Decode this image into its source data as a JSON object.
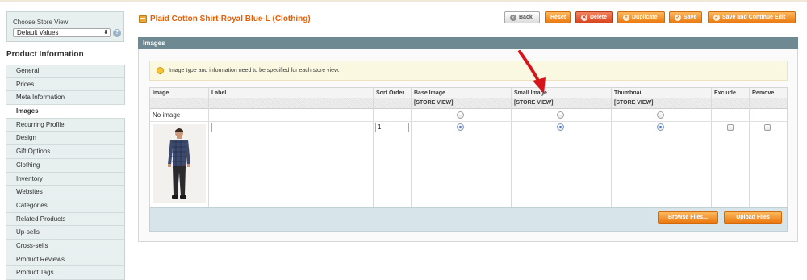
{
  "sidebar": {
    "store_view_label": "Choose Store View:",
    "store_view_value": "Default Values",
    "section_title": "Product Information",
    "items": [
      {
        "label": "General",
        "active": false
      },
      {
        "label": "Prices",
        "active": false
      },
      {
        "label": "Meta Information",
        "active": false
      },
      {
        "label": "Images",
        "active": true
      },
      {
        "label": "Recurring Profile",
        "active": false
      },
      {
        "label": "Design",
        "active": false
      },
      {
        "label": "Gift Options",
        "active": false
      },
      {
        "label": "Clothing",
        "active": false
      },
      {
        "label": "Inventory",
        "active": false
      },
      {
        "label": "Websites",
        "active": false
      },
      {
        "label": "Categories",
        "active": false
      },
      {
        "label": "Related Products",
        "active": false
      },
      {
        "label": "Up-sells",
        "active": false
      },
      {
        "label": "Cross-sells",
        "active": false
      },
      {
        "label": "Product Reviews",
        "active": false
      },
      {
        "label": "Product Tags",
        "active": false
      }
    ]
  },
  "header": {
    "title": "Plaid Cotton Shirt-Royal Blue-L (Clothing)",
    "buttons": {
      "back": "Back",
      "reset": "Reset",
      "delete": "Delete",
      "duplicate": "Duplicate",
      "save": "Save",
      "save_continue": "Save and Continue Edit"
    }
  },
  "images_section": {
    "title": "Images",
    "notice": "Image type and information need to be specified for each store view.",
    "columns": {
      "image": "Image",
      "label": "Label",
      "sort_order": "Sort Order",
      "base_image": "Base Image",
      "small_image": "Small Image",
      "thumbnail": "Thumbnail",
      "exclude": "Exclude",
      "remove": "Remove",
      "scope": "[STORE VIEW]"
    },
    "no_image_label": "No image",
    "row": {
      "label_value": "",
      "sort_order_value": "1",
      "base_image_checked": true,
      "small_image_checked": true,
      "thumbnail_checked": true,
      "exclude_checked": false,
      "remove_checked": false
    },
    "footer": {
      "browse": "Browse Files...",
      "upload": "Upload Files"
    }
  },
  "colors": {
    "accent_orange": "#eb7a10",
    "title_orange": "#eb5e00",
    "section_head": "#6f8992",
    "annotation_arrow": "#e01010"
  }
}
